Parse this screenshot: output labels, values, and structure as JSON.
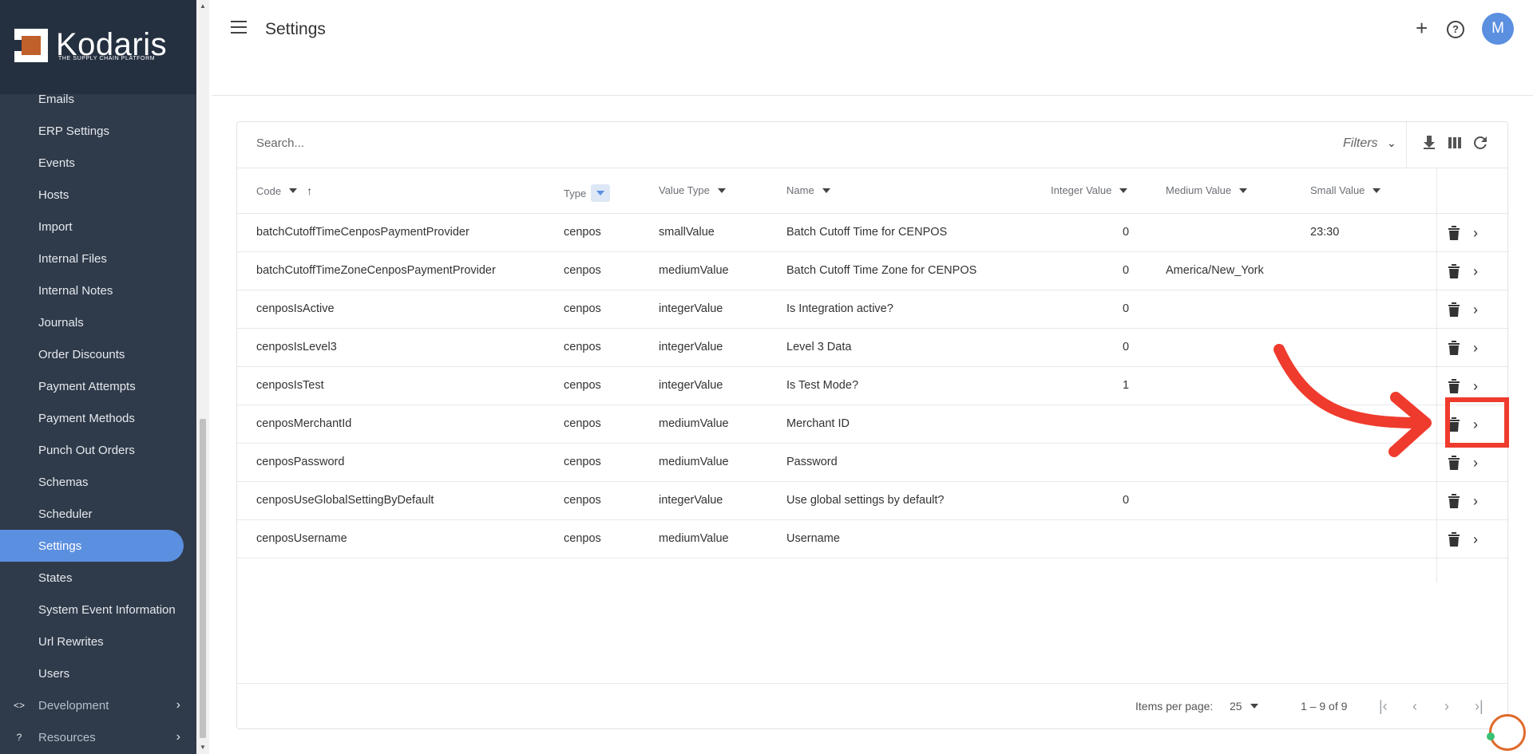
{
  "brand": {
    "name": "Kodaris",
    "tagline": "THE SUPPLY CHAIN PLATFORM",
    "accent": "#5b8fe0",
    "logo_color": "#c0602a"
  },
  "sidebar": {
    "items": [
      {
        "label": "Emails"
      },
      {
        "label": "ERP Settings"
      },
      {
        "label": "Events"
      },
      {
        "label": "Hosts"
      },
      {
        "label": "Import"
      },
      {
        "label": "Internal Files"
      },
      {
        "label": "Internal Notes"
      },
      {
        "label": "Journals"
      },
      {
        "label": "Order Discounts"
      },
      {
        "label": "Payment Attempts"
      },
      {
        "label": "Payment Methods"
      },
      {
        "label": "Punch Out Orders"
      },
      {
        "label": "Schemas"
      },
      {
        "label": "Scheduler"
      },
      {
        "label": "Settings",
        "active": true
      },
      {
        "label": "States"
      },
      {
        "label": "System Event Information"
      },
      {
        "label": "Url Rewrites"
      },
      {
        "label": "Users"
      }
    ],
    "groups": [
      {
        "label": "Development",
        "icon": "code-icon"
      },
      {
        "label": "Resources",
        "icon": "help-circle-icon"
      }
    ]
  },
  "header": {
    "title": "Settings",
    "avatar_initial": "M"
  },
  "toolbar": {
    "search_placeholder": "Search...",
    "filters_label": "Filters"
  },
  "table": {
    "columns": [
      "Code",
      "Type",
      "Value Type",
      "Name",
      "Integer Value",
      "Medium Value",
      "Small Value"
    ],
    "rows": [
      {
        "code": "batchCutoffTimeCenposPaymentProvider",
        "type": "cenpos",
        "value_type": "smallValue",
        "name": "Batch Cutoff Time for CENPOS",
        "integer": "0",
        "medium": "",
        "small": "23:30"
      },
      {
        "code": "batchCutoffTimeZoneCenposPaymentProvider",
        "type": "cenpos",
        "value_type": "mediumValue",
        "name": "Batch Cutoff Time Zone for CENPOS",
        "integer": "0",
        "medium": "America/New_York",
        "small": ""
      },
      {
        "code": "cenposIsActive",
        "type": "cenpos",
        "value_type": "integerValue",
        "name": "Is Integration active?",
        "integer": "0",
        "medium": "",
        "small": ""
      },
      {
        "code": "cenposIsLevel3",
        "type": "cenpos",
        "value_type": "integerValue",
        "name": "Level 3 Data",
        "integer": "0",
        "medium": "",
        "small": ""
      },
      {
        "code": "cenposIsTest",
        "type": "cenpos",
        "value_type": "integerValue",
        "name": "Is Test Mode?",
        "integer": "1",
        "medium": "",
        "small": ""
      },
      {
        "code": "cenposMerchantId",
        "type": "cenpos",
        "value_type": "mediumValue",
        "name": "Merchant ID",
        "integer": "",
        "medium": "",
        "small": ""
      },
      {
        "code": "cenposPassword",
        "type": "cenpos",
        "value_type": "mediumValue",
        "name": "Password",
        "integer": "",
        "medium": "",
        "small": ""
      },
      {
        "code": "cenposUseGlobalSettingByDefault",
        "type": "cenpos",
        "value_type": "integerValue",
        "name": "Use global settings by default?",
        "integer": "0",
        "medium": "",
        "small": ""
      },
      {
        "code": "cenposUsername",
        "type": "cenpos",
        "value_type": "mediumValue",
        "name": "Username",
        "integer": "",
        "medium": "",
        "small": ""
      }
    ]
  },
  "pagination": {
    "items_per_page_label": "Items per page:",
    "items_per_page": "25",
    "range": "1 – 9 of 9"
  },
  "annotation": {
    "color": "#ef3b2d"
  }
}
